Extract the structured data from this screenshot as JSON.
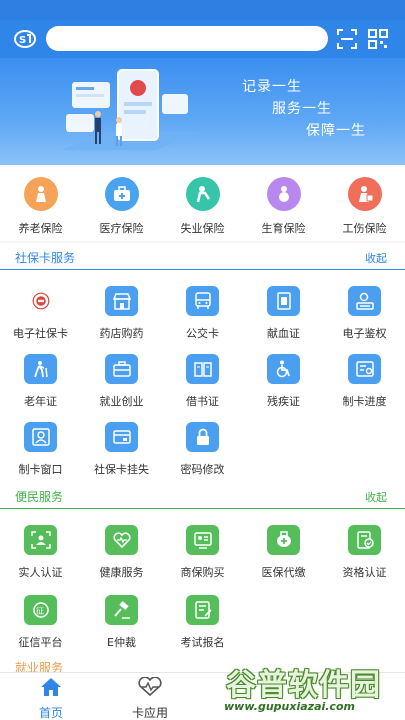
{
  "banner": {
    "slogans": [
      "记录一生",
      "服务一生",
      "保障一生"
    ]
  },
  "insurance": [
    {
      "label": "养老保险",
      "icon": "elderly-icon",
      "color": "#f6a35a"
    },
    {
      "label": "医疗保险",
      "icon": "medical-kit-icon",
      "color": "#4aa3ef"
    },
    {
      "label": "失业保险",
      "icon": "unemployment-icon",
      "color": "#36c5a8"
    },
    {
      "label": "生育保险",
      "icon": "maternity-icon",
      "color": "#b888ef"
    },
    {
      "label": "工伤保险",
      "icon": "injury-icon",
      "color": "#f06e5a"
    }
  ],
  "sections": {
    "card_service": {
      "title": "社保卡服务",
      "action": "收起",
      "color": "#2f86e8"
    },
    "convenience": {
      "title": "便民服务",
      "action": "收起",
      "color": "#41b34a"
    },
    "employment": {
      "title": "就业服务"
    }
  },
  "card_items": [
    {
      "label": "电子社保卡",
      "icon": "social-security-card-icon"
    },
    {
      "label": "药店购药",
      "icon": "pharmacy-icon"
    },
    {
      "label": "公交卡",
      "icon": "bus-icon"
    },
    {
      "label": "献血证",
      "icon": "blood-donation-icon"
    },
    {
      "label": "电子鉴权",
      "icon": "authentication-icon"
    },
    {
      "label": "老年证",
      "icon": "elderly-walk-icon"
    },
    {
      "label": "就业创业",
      "icon": "briefcase-icon"
    },
    {
      "label": "借书证",
      "icon": "book-icon"
    },
    {
      "label": "残疾证",
      "icon": "wheelchair-icon"
    },
    {
      "label": "制卡进度",
      "icon": "card-progress-icon"
    },
    {
      "label": "制卡窗口",
      "icon": "card-window-icon"
    },
    {
      "label": "社保卡挂失",
      "icon": "card-loss-icon"
    },
    {
      "label": "密码修改",
      "icon": "lock-icon"
    }
  ],
  "convenience_items": [
    {
      "label": "实人认证",
      "icon": "face-id-icon"
    },
    {
      "label": "健康服务",
      "icon": "health-heart-icon"
    },
    {
      "label": "商保购买",
      "icon": "insurance-purchase-icon"
    },
    {
      "label": "医保代缴",
      "icon": "medical-payment-icon"
    },
    {
      "label": "资格认证",
      "icon": "qualification-icon"
    },
    {
      "label": "征信平台",
      "icon": "credit-icon"
    },
    {
      "label": "E仲裁",
      "icon": "gavel-icon"
    },
    {
      "label": "考试报名",
      "icon": "exam-signup-icon"
    }
  ],
  "nav": {
    "home": "首页",
    "card_apps": "卡应用"
  },
  "watermark": {
    "text": "谷普软件园",
    "url": "www.gupuxiazai.com"
  },
  "colors": {
    "primary": "#2f86e8",
    "green": "#41b34a",
    "icon_blue": "#4a9ff0"
  }
}
